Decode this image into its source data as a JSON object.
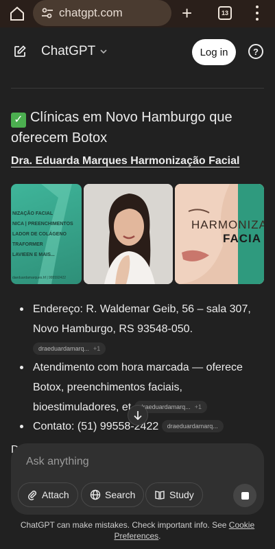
{
  "browser": {
    "url": "chatgpt.com",
    "tab_count": "13"
  },
  "header": {
    "title": "ChatGPT",
    "login_label": "Log in",
    "help_glyph": "?"
  },
  "content": {
    "heading": "Clínicas em Novo Hamburgo que oferecem Botox",
    "heading_emoji": "✓",
    "subheading": "Dra. Eduarda Marques Harmonização Facial",
    "images": {
      "img1_lines": [
        "NIZAÇÃO FACIAL",
        "NICA | PREENCHIMENTOS",
        "LADOR DE COLÁGENO",
        "TRAFORMER",
        "LAVIEEN E MAIS...",
        "daeduardamarques.hf | 995592422"
      ],
      "img3_text1": "HARMONIZA",
      "img3_text2": "FACIA"
    },
    "bullets": [
      {
        "text": "Endereço: R. Waldemar Geib, 56 – sala 307, Novo Hamburgo, RS 93548-050.",
        "chip": "draeduardamarq...",
        "chip_count": "+1"
      },
      {
        "text": "Atendimento com hora marcada — oferece Botox, preenchimentos faciais, bioestimuladores, et",
        "chip": "draeduardamarq...",
        "chip_count": "+1"
      },
      {
        "text": "Contato: (51) 99558-2422",
        "chip": "draeduardamarq..."
      }
    ],
    "partial_next": "D"
  },
  "composer": {
    "placeholder": "Ask anything",
    "attach_label": "Attach",
    "search_label": "Search",
    "study_label": "Study"
  },
  "footer": {
    "text": "ChatGPT can make mistakes. Check important info. See ",
    "link": "Cookie Preferences",
    "end": "."
  },
  "colors": {
    "background": "#212121",
    "composer": "#303030",
    "browser_bar": "#2a1f1a",
    "accent_green": "#2f9a7e"
  }
}
